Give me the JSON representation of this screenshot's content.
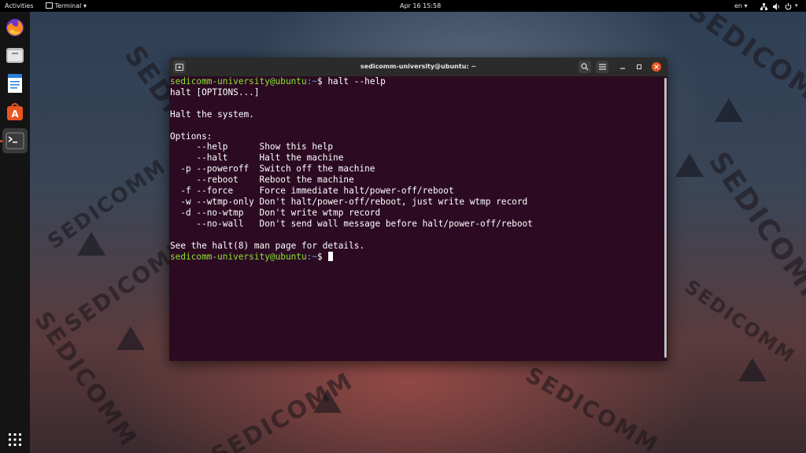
{
  "topbar": {
    "activities": "Activities",
    "app_menu": "Terminal",
    "app_menu_arrow": "▾",
    "clock": "Apr 16  15:58",
    "lang": "en",
    "lang_arrow": "▾"
  },
  "dock": {
    "items": [
      {
        "name": "Firefox",
        "icon": "firefox-icon"
      },
      {
        "name": "Files",
        "icon": "files-icon"
      },
      {
        "name": "LibreOffice Writer",
        "icon": "writer-icon"
      },
      {
        "name": "Ubuntu Software",
        "icon": "software-icon"
      },
      {
        "name": "Terminal",
        "icon": "terminal-icon",
        "active": true
      }
    ],
    "show_apps_icon": "grid-icon"
  },
  "watermark_text": "SEDICOMM",
  "terminal": {
    "title": "sedicomm-university@ubuntu: ~",
    "prompt_user": "sedicomm-university@ubuntu",
    "prompt_path": ":~",
    "prompt_symbol": "$",
    "command": " halt --help",
    "output": [
      "halt [OPTIONS...]",
      "",
      "Halt the system.",
      "",
      "Options:",
      "     --help      Show this help",
      "     --halt      Halt the machine",
      "  -p --poweroff  Switch off the machine",
      "     --reboot    Reboot the machine",
      "  -f --force     Force immediate halt/power-off/reboot",
      "  -w --wtmp-only Don't halt/power-off/reboot, just write wtmp record",
      "  -d --no-wtmp   Don't write wtmp record",
      "     --no-wall   Don't send wall message before halt/power-off/reboot",
      "",
      "See the halt(8) man page for details."
    ]
  },
  "colors": {
    "terminal_bg": "#2c0b22",
    "prompt_user": "#8ae234",
    "prompt_path": "#729fcf",
    "close_button": "#e95420"
  }
}
